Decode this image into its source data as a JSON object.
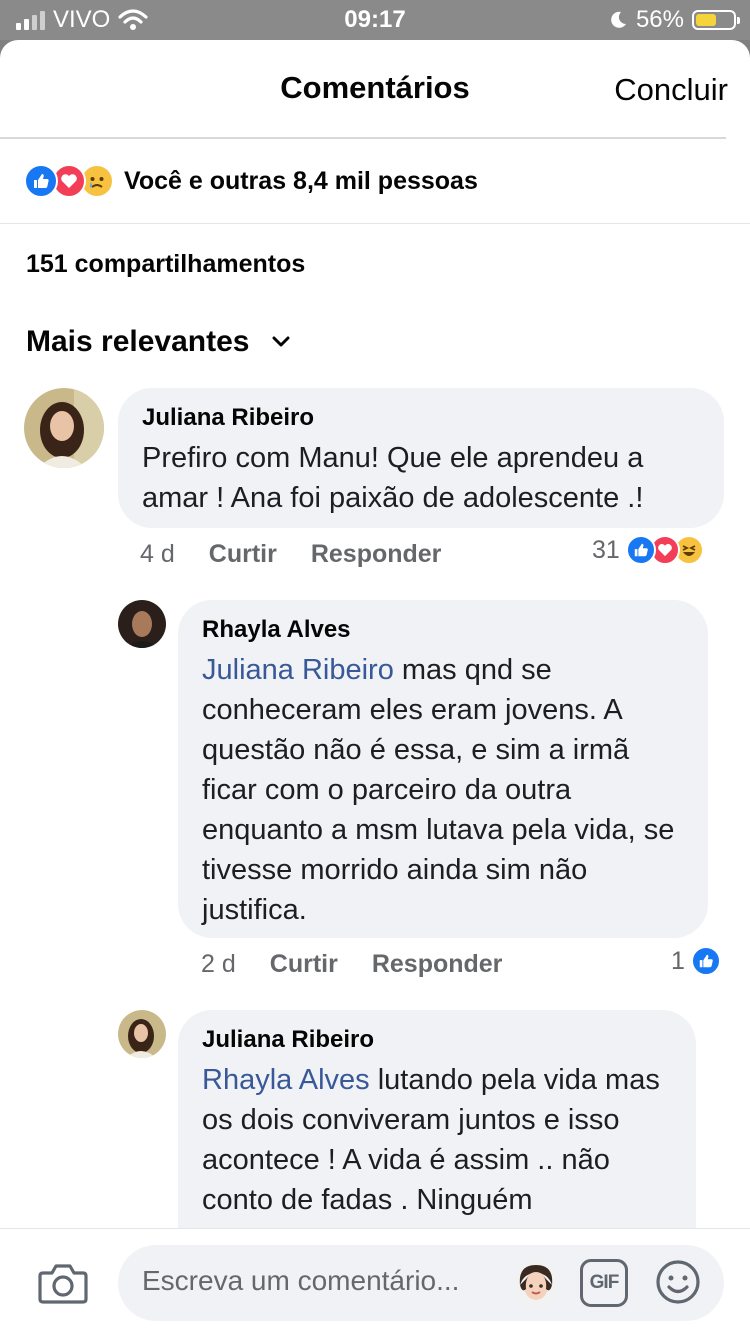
{
  "status_bar": {
    "carrier": "VIVO",
    "time": "09:17",
    "battery": "56%"
  },
  "header": {
    "title": "Comentários",
    "done_label": "Concluir"
  },
  "post": {
    "reactions_text": "Você e outras 8,4 mil pessoas",
    "shares_text": "151 compartilhamentos"
  },
  "sort": {
    "label": "Mais relevantes"
  },
  "comments": [
    {
      "author": "Juliana Ribeiro",
      "text": "Prefiro com Manu! Que ele aprendeu a amar ! Ana foi paixão de adolescente .!",
      "time": "4 d",
      "like_label": "Curtir",
      "reply_label": "Responder",
      "reaction_count": "31"
    },
    {
      "author": "Rhayla Alves",
      "mention": "Juliana Ribeiro",
      "text": " mas qnd se conheceram eles eram jovens. A questão não é essa, e sim a irmã ficar com o parceiro da outra enquanto a msm lutava pela vida, se tivesse morrido ainda sim não justifica.",
      "time": "2 d",
      "like_label": "Curtir",
      "reply_label": "Responder",
      "reaction_count": "1"
    },
    {
      "author": "Juliana Ribeiro",
      "mention": "Rhayla Alves",
      "text": " lutando pela vida mas os dois conviveram juntos e isso acontece ! A vida é assim .. não conto de fadas . Ninguém "
    }
  ],
  "composer": {
    "placeholder": "Escreva um comentário...",
    "gif_label": "GIF"
  },
  "icons": {
    "camera": "camera-icon",
    "emoji": "smiley-icon",
    "chevron": "chevron-down-icon",
    "like": "like-reaction-icon",
    "love": "love-reaction-icon",
    "sad": "sad-reaction-icon",
    "haha": "haha-reaction-icon"
  },
  "colors": {
    "link": "#385898",
    "like_blue": "#1877f2",
    "love_red": "#f33e58",
    "bubble": "#f0f2f5"
  }
}
